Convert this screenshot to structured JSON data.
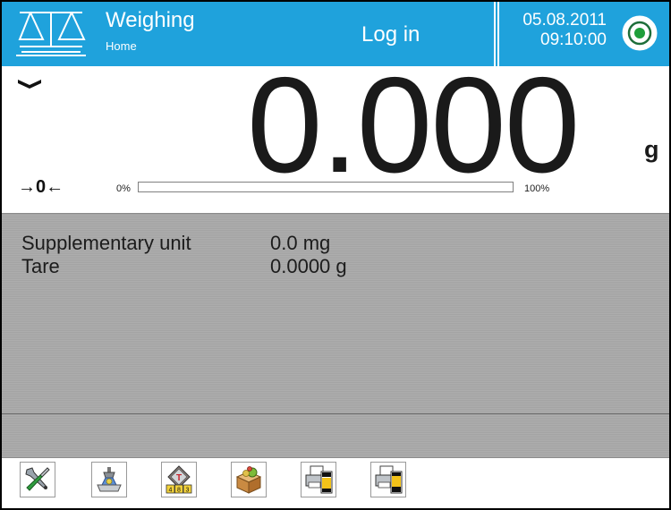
{
  "header": {
    "title": "Weighing",
    "subtitle": "Home",
    "login_label": "Log in",
    "date": "05.08.2011",
    "time": "09:10:00",
    "logo_icon": "balance-scale-icon",
    "status_icon": "record-status-icon"
  },
  "display": {
    "value": "0.000",
    "unit": "g",
    "zero_indicator": "→0←",
    "stable_icon": "stability-marker-icon",
    "range_start_label": "0%",
    "range_end_label": "100%",
    "load_fraction": 0
  },
  "info": {
    "rows": [
      {
        "label": "Supplementary unit",
        "value": "0.0 mg"
      },
      {
        "label": "Tare",
        "value": "0.0000 g"
      }
    ]
  },
  "toolbar": {
    "buttons": [
      {
        "icon": "settings-tools-icon"
      },
      {
        "icon": "tare-weight-icon"
      },
      {
        "icon": "manual-tare-keypad-icon"
      },
      {
        "icon": "product-database-icon"
      },
      {
        "icon": "print-header-icon"
      },
      {
        "icon": "print-footer-icon"
      }
    ]
  },
  "colors": {
    "header_bg": "#1fa2dc",
    "panel_bg": "#a4a4a4",
    "status_green": "#1e9e3a"
  }
}
